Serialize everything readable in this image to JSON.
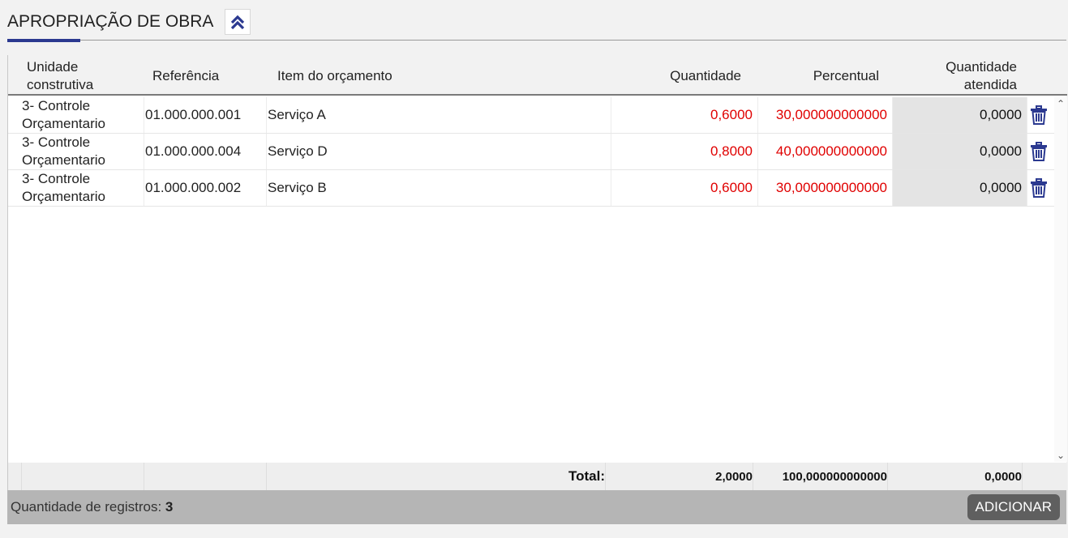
{
  "header": {
    "title": "APROPRIAÇÃO DE OBRA",
    "collapse_icon": "chevrons-up-icon",
    "accent_color": "#2b3990"
  },
  "columns": {
    "unidade": "Unidade construtiva",
    "referencia": "Referência",
    "item": "Item do orçamento",
    "quantidade": "Quantidade",
    "percentual": "Percentual",
    "atendida": "Quantidade atendida"
  },
  "rows": [
    {
      "unidade": "3- Controle Orçamentario",
      "referencia": "01.000.000.001",
      "item": "Serviço A",
      "quantidade": "0,6000",
      "percentual": "30,000000000000",
      "atendida": "0,0000",
      "action_icon": "trash-icon"
    },
    {
      "unidade": "3- Controle Orçamentario",
      "referencia": "01.000.000.004",
      "item": "Serviço D",
      "quantidade": "0,8000",
      "percentual": "40,000000000000",
      "atendida": "0,0000",
      "action_icon": "trash-icon"
    },
    {
      "unidade": "3- Controle Orçamentario",
      "referencia": "01.000.000.002",
      "item": "Serviço B",
      "quantidade": "0,6000",
      "percentual": "30,000000000000",
      "atendida": "0,0000",
      "action_icon": "trash-icon"
    }
  ],
  "footer": {
    "label": "Total:",
    "quantidade": "2,0000",
    "percentual": "100,000000000000",
    "atendida": "0,0000"
  },
  "status": {
    "records_label": "Quantidade de registros:",
    "records_count": "3"
  },
  "actions": {
    "add_label": "ADICIONAR"
  },
  "colors": {
    "highlight_red": "#e00000",
    "status_bar": "#b5b5b5",
    "button_bg": "#5f5f5f"
  }
}
